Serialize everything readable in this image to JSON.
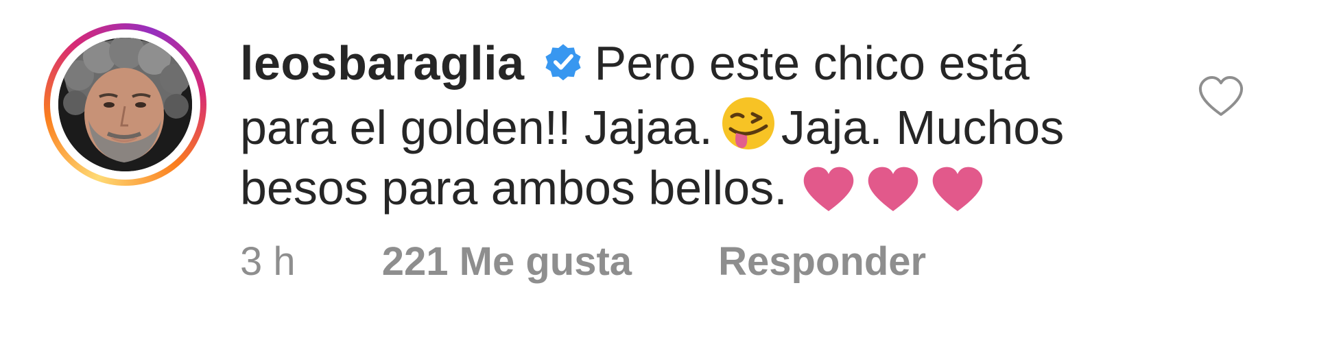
{
  "comment": {
    "username": "leosbaraglia",
    "verified": true,
    "text_line1": "Pero este chico está",
    "text_line2a": "para el golden!! Jajaa.",
    "text_line2b": "Jaja. Muchos",
    "text_line3": "besos para ambos bellos.",
    "emoji_names": [
      "zany-face-icon",
      "pink-heart-icon",
      "pink-heart-icon",
      "pink-heart-icon"
    ]
  },
  "meta": {
    "time": "3 h",
    "likes": "221 Me gusta",
    "reply": "Responder"
  },
  "colors": {
    "text": "#262626",
    "meta": "#8e8e8e",
    "verified_blue": "#3897f0",
    "heart_pink": "#e2598b",
    "emoji_yellow": "#f7c325"
  }
}
